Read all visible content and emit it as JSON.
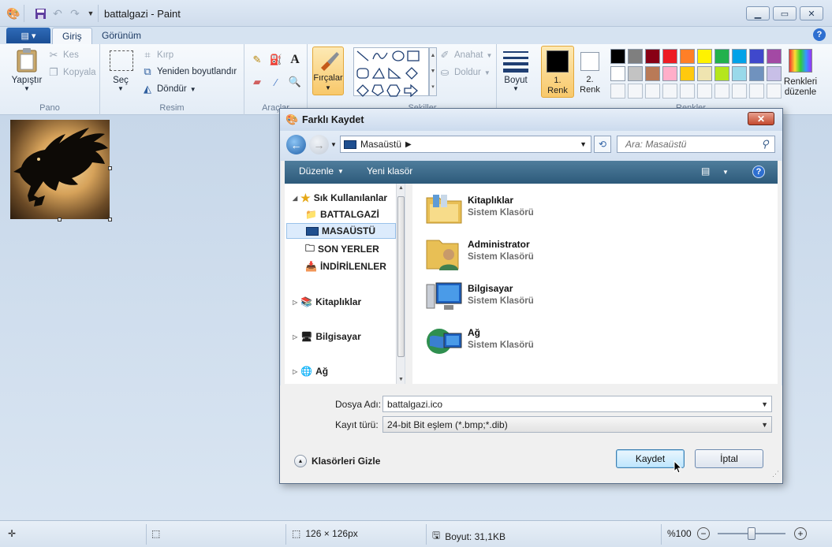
{
  "window": {
    "title": "battalgazi - Paint",
    "tabs": [
      "Giriş",
      "Görünüm"
    ],
    "help": "?"
  },
  "ribbon": {
    "pano": {
      "label": "Pano",
      "paste": "Yapıştır",
      "cut": "Kes",
      "copy": "Kopyala"
    },
    "resim": {
      "label": "Resim",
      "select": "Seç",
      "crop": "Kırp",
      "resize": "Yeniden boyutlandır",
      "rotate": "Döndür"
    },
    "araclar": {
      "label": "Araçlar",
      "brushes": "Fırçalar"
    },
    "sekiller": {
      "label": "Şekiller",
      "outline": "Anahat",
      "fill": "Doldur"
    },
    "boyut": {
      "label": "Boyut"
    },
    "renk1": {
      "line1": "1.",
      "line2": "Renk"
    },
    "renk2": {
      "line1": "2.",
      "line2": "Renk"
    },
    "renkler": {
      "label": "Renkler",
      "edit_line1": "Renkleri",
      "edit_line2": "düzenle"
    },
    "palette_row1": [
      "#000000",
      "#7f7f7f",
      "#880015",
      "#ed1c24",
      "#ff7f27",
      "#fff200",
      "#22b14c",
      "#00a2e8",
      "#3f48cc",
      "#a349a4"
    ],
    "palette_row2": [
      "#ffffff",
      "#c3c3c3",
      "#b97a57",
      "#ffaec9",
      "#ffc90e",
      "#efe4b0",
      "#b5e61d",
      "#99d9ea",
      "#7092be",
      "#c8bfe7"
    ]
  },
  "status": {
    "dimensions": "126 × 126px",
    "size": "Boyut: 31,1KB",
    "zoom": "%100"
  },
  "dialog": {
    "title": "Farklı Kaydet",
    "address": "Masaüstü",
    "search_placeholder": "Ara: Masaüstü",
    "toolbar": {
      "organize": "Düzenle",
      "new_folder": "Yeni klasör"
    },
    "nav": {
      "favorites": "Sık Kullanılanlar",
      "fav_items": [
        "BATTALGAZİ",
        "MASAÜSTÜ",
        "SON YERLER",
        "İNDİRİLENLER"
      ],
      "libraries": "Kitaplıklar",
      "computer": "Bilgisayar",
      "network": "Ağ"
    },
    "files": [
      {
        "name": "Kitaplıklar",
        "type": "Sistem Klasörü"
      },
      {
        "name": "Administrator",
        "type": "Sistem Klasörü"
      },
      {
        "name": "Bilgisayar",
        "type": "Sistem Klasörü"
      },
      {
        "name": "Ağ",
        "type": "Sistem Klasörü"
      }
    ],
    "filename_label": "Dosya Adı:",
    "filename_value": "battalgazi.ico",
    "filetype_label": "Kayıt türü:",
    "filetype_value": "24-bit Bit eşlem (*.bmp;*.dib)",
    "hide_folders": "Klasörleri Gizle",
    "save": "Kaydet",
    "cancel": "İptal"
  }
}
